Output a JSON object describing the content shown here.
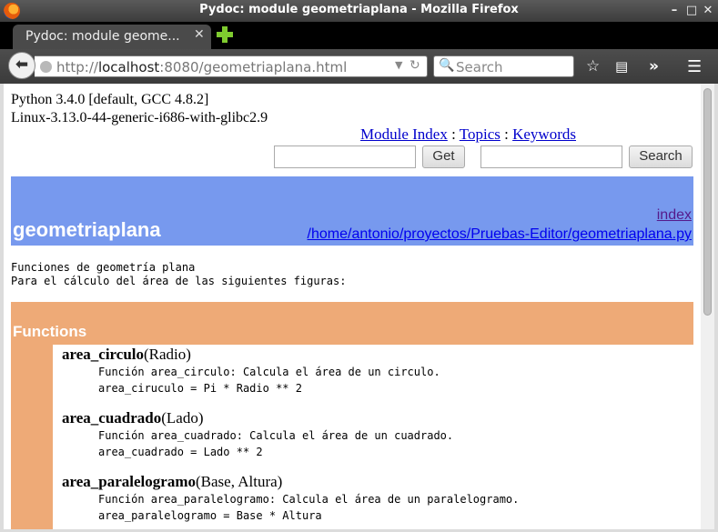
{
  "window": {
    "title": "Pydoc: module geometriaplana - Mozilla Firefox",
    "minimize": "–",
    "maximize": "□",
    "close": "✕"
  },
  "tab": {
    "label": "Pydoc: module geome...",
    "close": "✕"
  },
  "navbar": {
    "url_prefix": "http://",
    "url_host": "localhost",
    "url_rest": ":8080/geometriaplana.html",
    "search_placeholder": "Search"
  },
  "page": {
    "python_version": "Python 3.4.0 [default, GCC 4.8.2]",
    "platform": "Linux-3.13.0-44-generic-i686-with-glibc2.9",
    "links": {
      "module_index": "Module Index",
      "sep1": ":",
      "topics": "Topics",
      "sep2": ":",
      "keywords": "Keywords"
    },
    "get_button": "Get",
    "search_button": "Search",
    "module_title": "geometriaplana",
    "index_link": "index",
    "path_link": "/home/antonio/proyectos/Pruebas-Editor/geometriaplana.py",
    "doc_lines": [
      "Funciones de geometría plana",
      "Para el cálculo del área de las siguientes figuras:"
    ],
    "functions_heading": "Functions",
    "functions": [
      {
        "name": "area_circulo",
        "args": "(Radio)",
        "doc1": "Función area_circulo: Calcula el área de un circulo.",
        "doc2": "area_ciruculo = Pi * Radio ** 2"
      },
      {
        "name": "area_cuadrado",
        "args": "(Lado)",
        "doc1": "Función area_cuadrado: Calcula el área de un cuadrado.",
        "doc2": "area_cuadrado = Lado ** 2"
      },
      {
        "name": "area_paralelogramo",
        "args": "(Base, Altura)",
        "doc1": "Función area_paralelogramo: Calcula el área de un paralelogramo.",
        "doc2": "area_paralelogramo = Base * Altura"
      }
    ]
  },
  "colors": {
    "heading_bar": "#7799ee",
    "functions_bar": "#eeaa77"
  }
}
